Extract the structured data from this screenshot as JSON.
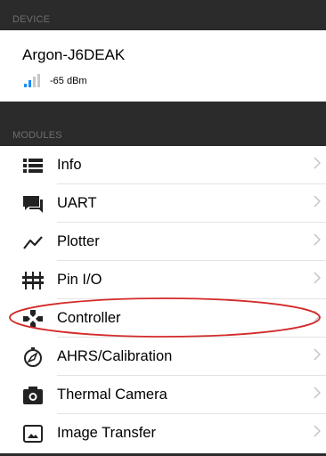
{
  "device_section": {
    "header": "DEVICE"
  },
  "device": {
    "name": "Argon-J6DEAK",
    "rssi": "-65 dBm"
  },
  "modules_section": {
    "header": "MODULES"
  },
  "modules": [
    {
      "label": "Info",
      "icon": "list-icon"
    },
    {
      "label": "UART",
      "icon": "chat-icon"
    },
    {
      "label": "Plotter",
      "icon": "chart-line-icon"
    },
    {
      "label": "Pin I/O",
      "icon": "pins-icon"
    },
    {
      "label": "Controller",
      "icon": "gamepad-icon"
    },
    {
      "label": "AHRS/Calibration",
      "icon": "compass-icon"
    },
    {
      "label": "Thermal Camera",
      "icon": "camera-icon"
    },
    {
      "label": "Image Transfer",
      "icon": "image-icon"
    }
  ],
  "colors": {
    "header_bg": "#2b2b2b",
    "signal_active": "#1a8cff",
    "highlight": "#d42a2a"
  }
}
